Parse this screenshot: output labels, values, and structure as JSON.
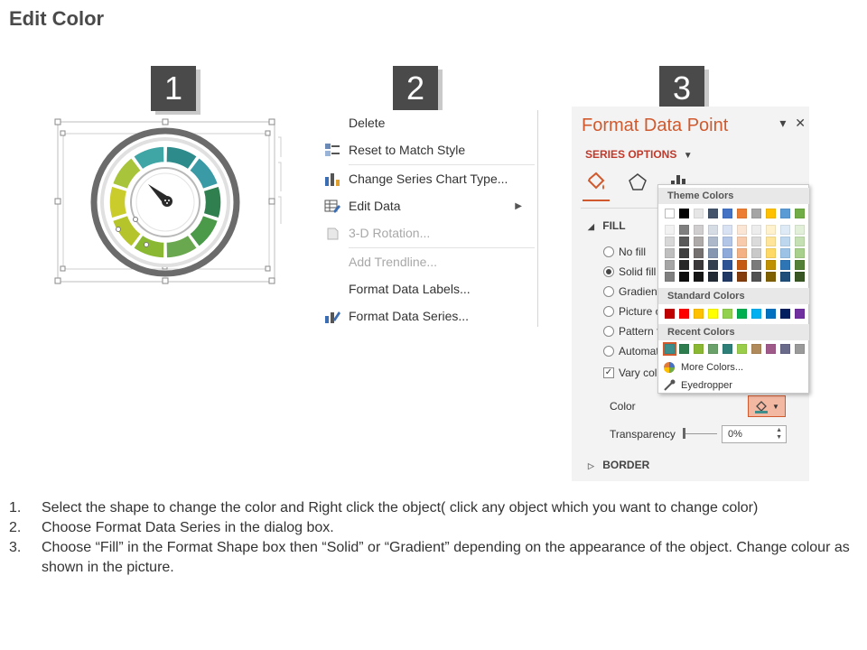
{
  "title": "Edit Color",
  "badges": [
    "1",
    "2",
    "3"
  ],
  "context_menu": {
    "items": [
      {
        "label": "Delete",
        "icon": "none",
        "disabled": false,
        "submenu": false
      },
      {
        "label": "Reset to Match Style",
        "icon": "reset-style-icon",
        "disabled": false,
        "submenu": false
      },
      {
        "label": "Change Series Chart Type...",
        "icon": "chart-type-icon",
        "disabled": false,
        "submenu": false
      },
      {
        "label": "Edit Data",
        "icon": "edit-data-icon",
        "disabled": false,
        "submenu": true
      },
      {
        "label": "3-D Rotation...",
        "icon": "rotation-icon",
        "disabled": true,
        "submenu": false
      },
      {
        "label": "Add Trendline...",
        "icon": "none",
        "disabled": true,
        "submenu": false
      },
      {
        "label": "Format Data Labels...",
        "icon": "none",
        "disabled": false,
        "submenu": false
      },
      {
        "label": "Format Data Series...",
        "icon": "format-series-icon",
        "disabled": false,
        "submenu": false
      }
    ]
  },
  "format_pane": {
    "title": "Format Data Point",
    "close_glyph": "✕",
    "menu_glyph": "▾",
    "series_options": "SERIES OPTIONS",
    "fill_header": "FILL",
    "fill_options": [
      {
        "label": "No fill",
        "selected": false
      },
      {
        "label": "Solid fill",
        "selected": true
      },
      {
        "label": "Gradient",
        "selected": false
      },
      {
        "label": "Picture o",
        "selected": false
      },
      {
        "label": "Pattern f",
        "selected": false
      },
      {
        "label": "Automat",
        "selected": false
      }
    ],
    "vary_colors": "Vary colo",
    "color_label": "Color",
    "transparency_label": "Transparency",
    "transparency_value": "0%",
    "border_header": "BORDER",
    "accent_color": "#d05a2e"
  },
  "color_picker": {
    "theme_header": "Theme Colors",
    "standard_header": "Standard Colors",
    "recent_header": "Recent Colors",
    "more_colors": "More Colors...",
    "eyedropper": "Eyedropper",
    "theme_top": [
      "#ffffff",
      "#000000",
      "#e7e6e6",
      "#44546a",
      "#4472c4",
      "#ed7d31",
      "#a5a5a5",
      "#ffc000",
      "#5b9bd5",
      "#70ad47"
    ],
    "theme_shades": [
      [
        "#f2f2f2",
        "#7f7f7f",
        "#d0cece",
        "#d6dce4",
        "#d9e2f3",
        "#fbe5d5",
        "#ededed",
        "#fff2cc",
        "#deebf6",
        "#e2efd9"
      ],
      [
        "#d8d8d8",
        "#595959",
        "#aeaaaa",
        "#adb9ca",
        "#b4c6e7",
        "#f7cbac",
        "#dbdbdb",
        "#fee599",
        "#bdd7ee",
        "#c5e0b3"
      ],
      [
        "#bfbfbf",
        "#3f3f3f",
        "#757070",
        "#8496b0",
        "#8eaadb",
        "#f4b183",
        "#c9c9c9",
        "#ffd965",
        "#9cc3e5",
        "#a8d08d"
      ],
      [
        "#a5a5a5",
        "#262626",
        "#3a3838",
        "#323f4f",
        "#2f5496",
        "#c55a11",
        "#7b7b7b",
        "#bf9000",
        "#2e75b5",
        "#538135"
      ],
      [
        "#7f7f7f",
        "#0c0c0c",
        "#171616",
        "#222a35",
        "#1f3864",
        "#833c0b",
        "#525252",
        "#7f6000",
        "#1e4e79",
        "#375623"
      ]
    ],
    "standard": [
      "#c00000",
      "#ff0000",
      "#ffc000",
      "#ffff00",
      "#92d050",
      "#00b050",
      "#00b0f0",
      "#0070c0",
      "#002060",
      "#7030a0"
    ],
    "recent": [
      "#3e8f8b",
      "#2e7d4f",
      "#8ab833",
      "#6aa06a",
      "#2f7f79",
      "#9acd4a",
      "#b08a5a",
      "#a05a8a",
      "#6a6a8a",
      "#9a9a9a"
    ]
  },
  "steps": [
    {
      "num": "1.",
      "text": "Select the shape to change the color and Right click the object( click any object which you want to change color)"
    },
    {
      "num": "2.",
      "text": "Choose Format Data Series in the dialog box."
    },
    {
      "num": "3.",
      "text": "Choose “Fill” in the Format Shape box then “Solid” or “Gradient” depending on the appearance of the object. Change colour as shown in the picture."
    }
  ],
  "gauge": {
    "segment_colors": [
      "#2e8b8b",
      "#3a9aa6",
      "#2f7f4f",
      "#4a9a4a",
      "#6aa84f",
      "#8ab833",
      "#b5c42a",
      "#c9cc2a",
      "#a8c43a",
      "#3fa5a5"
    ]
  }
}
